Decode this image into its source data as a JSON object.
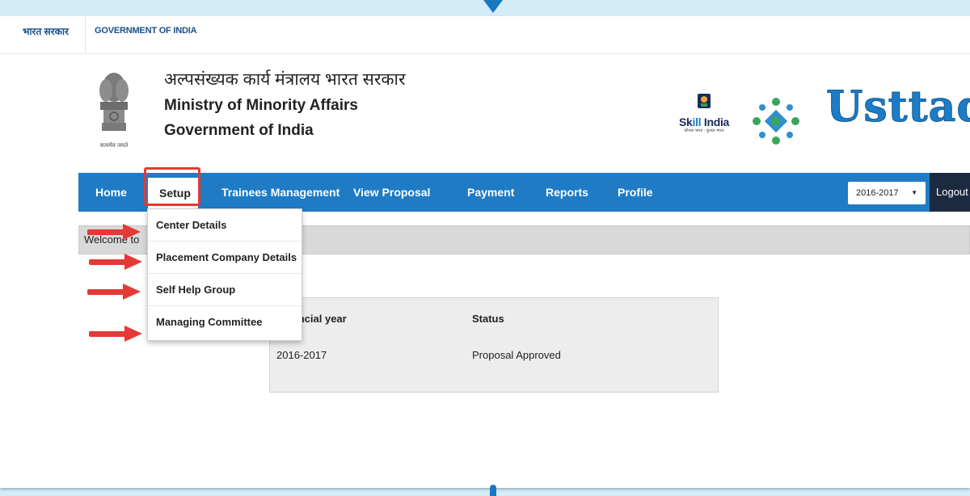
{
  "gov_bar": {
    "hindi": "भारत सरकार",
    "english": "GOVERNMENT OF INDIA"
  },
  "header": {
    "emblem_caption": "सत्यमेव जयते",
    "ministry_hindi": "अल्पसंख्यक कार्य मंत्रालय भारत सरकार",
    "ministry_english": "Ministry of Minority Affairs",
    "government": "Government of India",
    "skill_india": {
      "skill": "Sk",
      "ill": "ill",
      "india": " India",
      "tagline": "कौशल भारत - कुशल भारत"
    },
    "brand": "Usttad"
  },
  "nav": {
    "items": [
      "Home",
      "Setup",
      "Trainees Management",
      "View Proposal",
      "Payment",
      "Reports",
      "Profile"
    ],
    "active": "Setup",
    "year_selected": "2016-2017",
    "logout": "Logout"
  },
  "setup_menu": {
    "items": [
      "Center Details",
      "Placement Company Details",
      "Self Help Group",
      "Managing Committee"
    ]
  },
  "welcome": {
    "text": "Welcome to"
  },
  "status_table": {
    "headers": [
      "Financial year",
      "Status"
    ],
    "rows": [
      [
        "2016-2017",
        "Proposal Approved"
      ]
    ]
  },
  "colors": {
    "nav_blue": "#1f7bc4",
    "background": "#d4ecf8",
    "highlight_red": "#e53935",
    "logout_dark": "#1b2a40"
  },
  "icons": [
    "ashoka-emblem-icon",
    "skill-india-logo-icon",
    "usttad-mark-icon",
    "chevron-down-icon",
    "red-arrow-icon"
  ]
}
